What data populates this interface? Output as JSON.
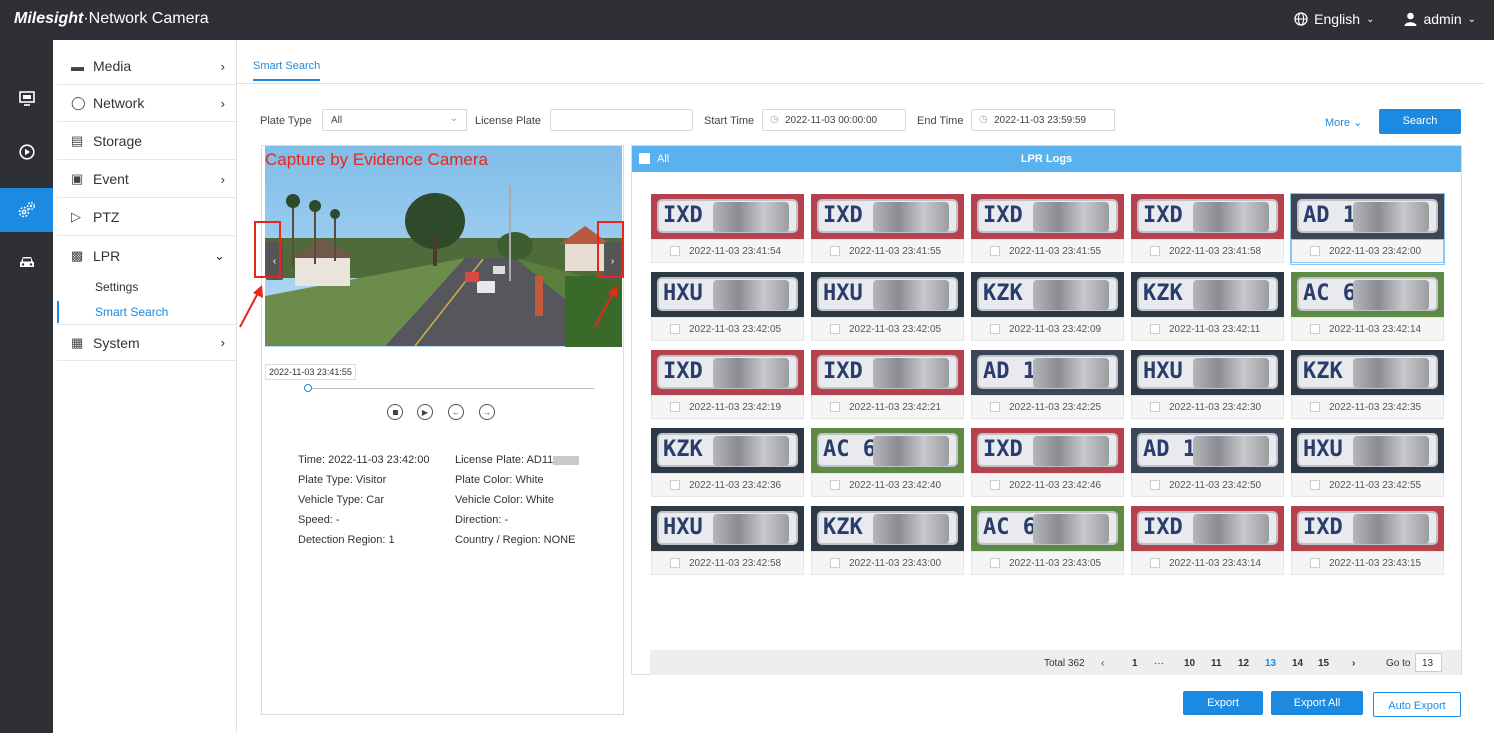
{
  "app": {
    "brand": "Milesight",
    "title": "·Network Camera"
  },
  "topbar": {
    "language": "English",
    "user": "admin"
  },
  "iconbar": {
    "items": [
      "monitor-icon",
      "playback-icon",
      "settings-icon",
      "vehicle-icon"
    ],
    "active": "settings-icon"
  },
  "sidebar": {
    "items": [
      {
        "label": "Media",
        "icon": "media-icon"
      },
      {
        "label": "Network",
        "icon": "globe-icon"
      },
      {
        "label": "Storage",
        "icon": "storage-icon"
      },
      {
        "label": "Event",
        "icon": "event-icon"
      },
      {
        "label": "PTZ",
        "icon": "ptz-icon"
      },
      {
        "label": "LPR",
        "icon": "car-icon"
      },
      {
        "label": "System",
        "icon": "system-icon"
      }
    ],
    "lpr_sub": {
      "settings": "Settings",
      "smart_search": "Smart Search"
    }
  },
  "tabs": {
    "active": "Smart Search"
  },
  "filters": {
    "plate_type_label": "Plate Type",
    "plate_type_value": "All",
    "license_plate_label": "License Plate",
    "license_plate_value": "",
    "start_time_label": "Start Time",
    "start_time_value": "2022-11-03 00:00:00",
    "end_time_label": "End Time",
    "end_time_value": "2022-11-03 23:59:59",
    "more": "More",
    "search": "Search"
  },
  "preview": {
    "overlay": "Capture by Evidence Camera",
    "timestamp": "2022-11-03 23:41:55",
    "progress": 0.0
  },
  "details": {
    "time": "Time: 2022-11-03 23:42:00",
    "license_plate": "License Plate: AD11",
    "plate_type": "Plate Type: Visitor",
    "plate_color": "Plate Color: White",
    "vehicle_type": "Vehicle Type: Car",
    "vehicle_color": "Vehicle Color: White",
    "speed": "Speed: -",
    "direction": "Direction: -",
    "detection_region": "Detection Region: 1",
    "country_region": "Country / Region: NONE"
  },
  "logs": {
    "all_label": "All",
    "title": "LPR Logs",
    "items": [
      {
        "plate": "IXD",
        "time": "2022-11-03 23:41:54",
        "bg": "#b5424e"
      },
      {
        "plate": "IXD",
        "time": "2022-11-03 23:41:55",
        "bg": "#b5424e"
      },
      {
        "plate": "IXD",
        "time": "2022-11-03 23:41:55",
        "bg": "#b5424e"
      },
      {
        "plate": "IXD",
        "time": "2022-11-03 23:41:58",
        "bg": "#b5424e"
      },
      {
        "plate": "AD 11",
        "time": "2022-11-03 23:42:00",
        "bg": "#3d4656"
      },
      {
        "plate": "HXU",
        "time": "2022-11-03 23:42:05",
        "bg": "#2d3a46"
      },
      {
        "plate": "HXU",
        "time": "2022-11-03 23:42:05",
        "bg": "#2d3a46"
      },
      {
        "plate": "KZK",
        "time": "2022-11-03 23:42:09",
        "bg": "#2d3a46"
      },
      {
        "plate": "KZK",
        "time": "2022-11-03 23:42:11",
        "bg": "#2d3a46"
      },
      {
        "plate": "AC 64",
        "time": "2022-11-03 23:42:14",
        "bg": "#5e8a45"
      },
      {
        "plate": "IXD",
        "time": "2022-11-03 23:42:19",
        "bg": "#b5424e"
      },
      {
        "plate": "IXD",
        "time": "2022-11-03 23:42:21",
        "bg": "#b5424e"
      },
      {
        "plate": "AD 11",
        "time": "2022-11-03 23:42:25",
        "bg": "#3d4656"
      },
      {
        "plate": "HXU",
        "time": "2022-11-03 23:42:30",
        "bg": "#2d3a46"
      },
      {
        "plate": "KZK",
        "time": "2022-11-03 23:42:35",
        "bg": "#2d3a46"
      },
      {
        "plate": "KZK",
        "time": "2022-11-03 23:42:36",
        "bg": "#2d3a46"
      },
      {
        "plate": "AC 64",
        "time": "2022-11-03 23:42:40",
        "bg": "#5e8a45"
      },
      {
        "plate": "IXD",
        "time": "2022-11-03 23:42:46",
        "bg": "#b5424e"
      },
      {
        "plate": "AD 11",
        "time": "2022-11-03 23:42:50",
        "bg": "#3d4656"
      },
      {
        "plate": "HXU",
        "time": "2022-11-03 23:42:55",
        "bg": "#2d3a46"
      },
      {
        "plate": "HXU",
        "time": "2022-11-03 23:42:58",
        "bg": "#2d3a46"
      },
      {
        "plate": "KZK",
        "time": "2022-11-03 23:43:00",
        "bg": "#2d3a46"
      },
      {
        "plate": "AC 64",
        "time": "2022-11-03 23:43:05",
        "bg": "#5e8a45"
      },
      {
        "plate": "IXD",
        "time": "2022-11-03 23:43:14",
        "bg": "#b5424e"
      },
      {
        "plate": "IXD",
        "time": "2022-11-03 23:43:15",
        "bg": "#b5424e"
      }
    ],
    "selected_index": 4
  },
  "pager": {
    "total": "Total 362",
    "pages": [
      "1",
      "···",
      "10",
      "11",
      "12",
      "13",
      "14",
      "15"
    ],
    "current": "13",
    "goto_label": "Go to",
    "goto_value": "13"
  },
  "actions": {
    "export": "Export",
    "export_all": "Export All",
    "auto_export": "Auto Export"
  },
  "colors": {
    "accent": "#1c8ae0",
    "header": "#2e3035",
    "log_header": "#59b2ee",
    "annotation": "#e8261b"
  }
}
